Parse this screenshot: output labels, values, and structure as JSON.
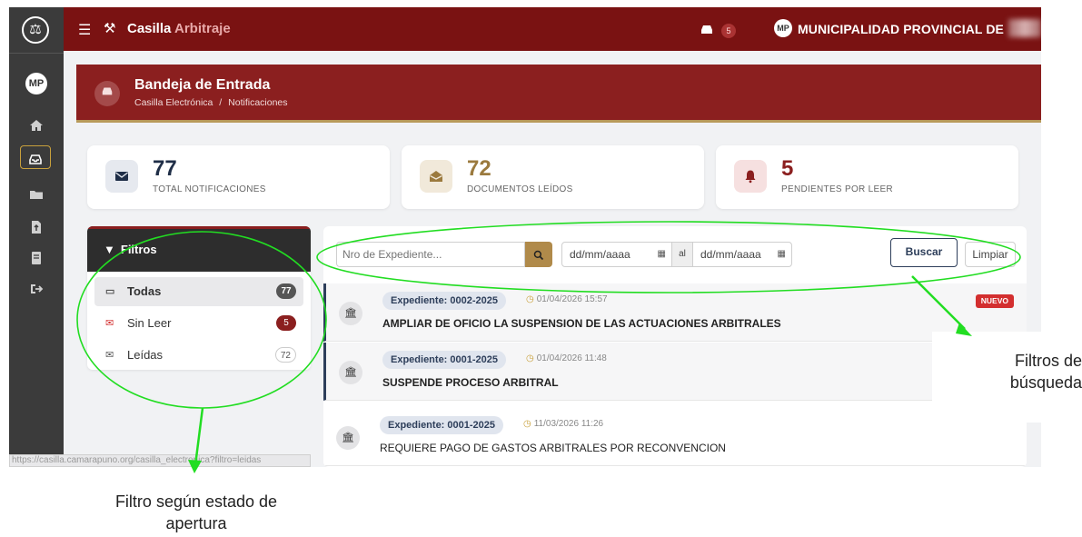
{
  "topbar": {
    "brand_main": "Casilla",
    "brand_accent": "Arbitraje",
    "inbox_badge": "5",
    "org_name": "MUNICIPALIDAD PROVINCIAL DE",
    "org_avatar": "MP"
  },
  "rail": {
    "logo": "⚖",
    "avatar": "MP",
    "items": [
      "home-icon",
      "inbox-icon",
      "folder-icon",
      "file-upload-icon",
      "book-icon",
      "sign-out-icon"
    ]
  },
  "page": {
    "title": "Bandeja de Entrada",
    "crumb_1": "Casilla Electrónica",
    "crumb_sep": "/",
    "crumb_2": "Notificaciones"
  },
  "stats": [
    {
      "value": "77",
      "label": "TOTAL NOTIFICACIONES",
      "color": "#1f2e47",
      "bg": "#e6e9ef",
      "icon": "envelope-icon"
    },
    {
      "value": "72",
      "label": "DOCUMENTOS LEÍDOS",
      "color": "#9b7a3e",
      "bg": "#f1e9da",
      "icon": "envelope-open-icon"
    },
    {
      "value": "5",
      "label": "PENDIENTES POR LEER",
      "color": "#8b1f1f",
      "bg": "#f6e0e0",
      "icon": "bell-icon"
    }
  ],
  "filters": {
    "title": "Filtros",
    "items": [
      {
        "label": "Todas",
        "count": "77"
      },
      {
        "label": "Sin Leer",
        "count": "5"
      },
      {
        "label": "Leídas",
        "count": "72"
      }
    ]
  },
  "search": {
    "expediente_placeholder": "Nro de Expediente...",
    "date_from": "dd/mm/aaaa",
    "date_sep": "al",
    "date_to": "dd/mm/aaaa",
    "buscar": "Buscar",
    "limpiar": "Limpiar"
  },
  "notifications": [
    {
      "expediente": "Expediente: 0002-2025",
      "datetime": "01/04/2026 15:57",
      "subject": "AMPLIAR DE OFICIO LA SUSPENSION DE LAS ACTUACIONES ARBITRALES",
      "badge": "NUEVO"
    },
    {
      "expediente": "Expediente: 0001-2025",
      "datetime": "01/04/2026 11:48",
      "subject": "SUSPENDE PROCESO ARBITRAL",
      "badge": ""
    },
    {
      "expediente": "Expediente: 0001-2025",
      "datetime": "11/03/2026 11:26",
      "subject": "REQUIERE PAGO DE GASTOS ARBITRALES POR RECONVENCION",
      "badge": ""
    }
  ],
  "status_url": "https://casilla.camarapuno.org/casilla_electronica?filtro=leidas",
  "annotations": {
    "search_filters_1": "Filtros de",
    "search_filters_2": "búsqueda",
    "state_filter_1": "Filtro según estado de",
    "state_filter_2": "apertura",
    "highlight_color": "#22dd22"
  }
}
